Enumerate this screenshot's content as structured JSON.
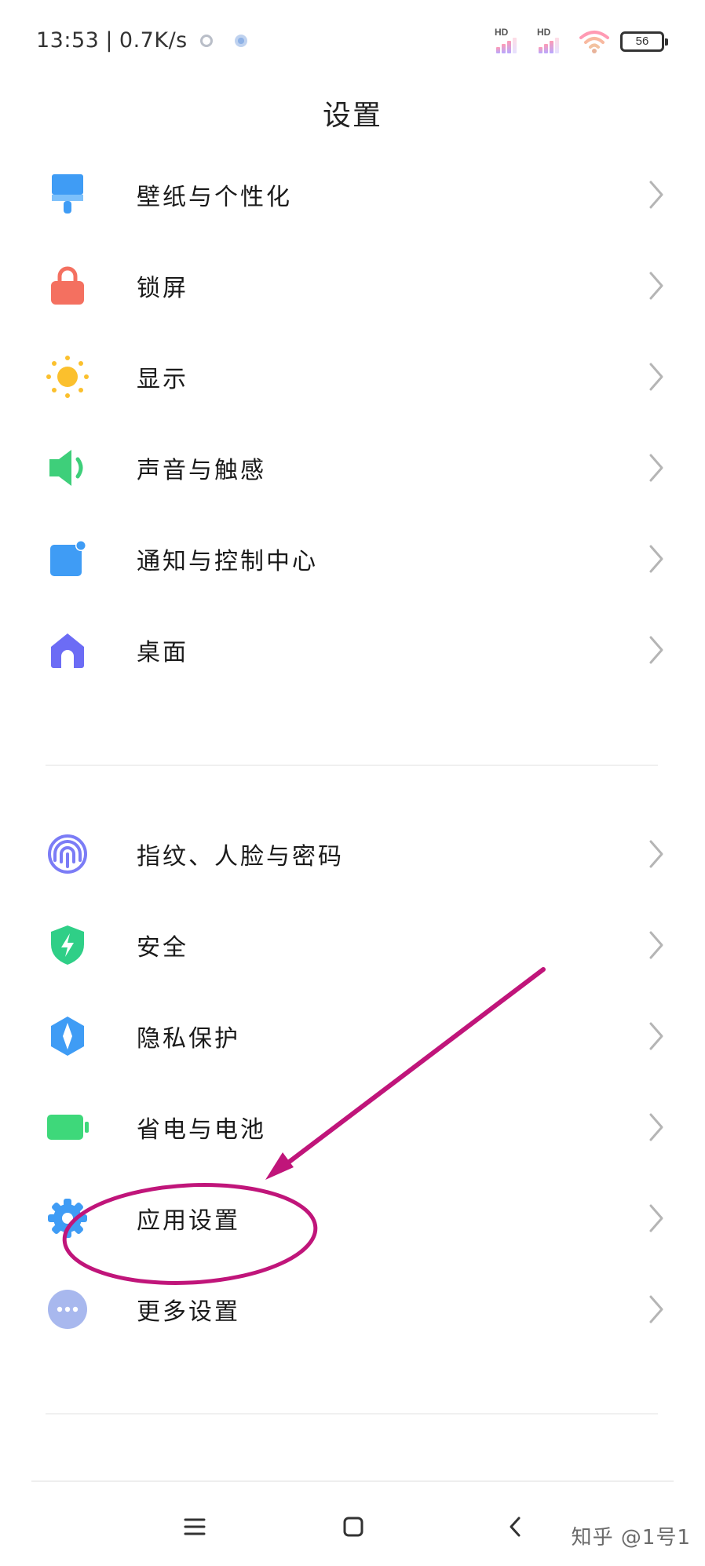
{
  "status_bar": {
    "time": "13:53",
    "separator": "|",
    "speed": "0.7K/s",
    "sim1_label": "HD",
    "sim2_label": "HD",
    "battery": "56"
  },
  "header": {
    "title": "设置"
  },
  "group1": [
    {
      "label": "壁纸与个性化",
      "icon": "wallpaper-brush-icon",
      "color": "#3f9cf5"
    },
    {
      "label": "锁屏",
      "icon": "lock-icon",
      "color": "#f47060"
    },
    {
      "label": "显示",
      "icon": "sun-icon",
      "color": "#fbc02d"
    },
    {
      "label": "声音与触感",
      "icon": "speaker-icon",
      "color": "#3ecf7a"
    },
    {
      "label": "通知与控制中心",
      "icon": "notification-icon",
      "color": "#3f9cf5"
    },
    {
      "label": "桌面",
      "icon": "home-icon",
      "color": "#6c6cf5"
    }
  ],
  "group2": [
    {
      "label": "指纹、人脸与密码",
      "icon": "fingerprint-icon",
      "color": "#7b7cf6"
    },
    {
      "label": "安全",
      "icon": "security-shield-icon",
      "color": "#2fcf87"
    },
    {
      "label": "隐私保护",
      "icon": "privacy-icon",
      "color": "#3f9cf5"
    },
    {
      "label": "省电与电池",
      "icon": "battery-icon",
      "color": "#3ed87a"
    },
    {
      "label": "应用设置",
      "icon": "app-settings-gear-icon",
      "color": "#3f9cf5"
    },
    {
      "label": "更多设置",
      "icon": "more-dots-icon",
      "color": "#a8b8ee"
    }
  ],
  "nav": {
    "menu": "menu-icon",
    "home": "home-square-icon",
    "back": "back-icon"
  },
  "watermark": "知乎 @1号1",
  "annotation_color": "#c0157a"
}
